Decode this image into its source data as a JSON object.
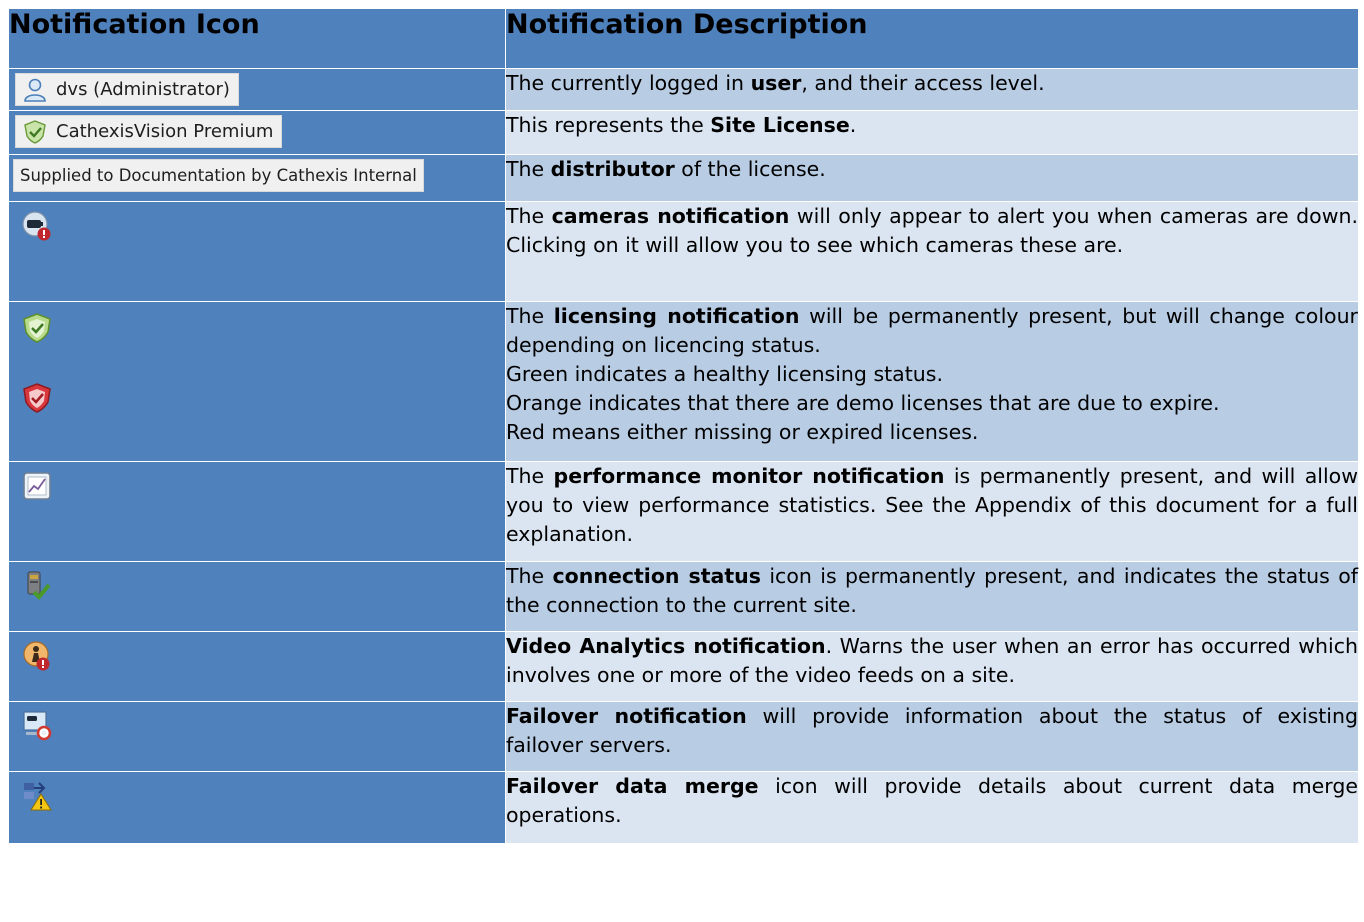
{
  "header": {
    "col_icon": "Notification Icon",
    "col_desc": "Notification Description"
  },
  "rows": [
    {
      "icon_text": "dvs (Administrator)",
      "icons": [
        "user-icon"
      ],
      "desc": [
        {
          "t": "The currently logged in "
        },
        {
          "t": "user",
          "b": true
        },
        {
          "t": ", and their access level."
        }
      ]
    },
    {
      "icon_text": "CathexisVision Premium",
      "icons": [
        "shield-check-green-icon"
      ],
      "desc": [
        {
          "t": "This represents the "
        },
        {
          "t": "Site License",
          "b": true
        },
        {
          "t": "."
        }
      ]
    },
    {
      "icon_text": "Supplied to Documentation by Cathexis Internal",
      "icons": [],
      "desc": [
        {
          "t": "The "
        },
        {
          "t": "distributor",
          "b": true
        },
        {
          "t": " of the license."
        }
      ]
    },
    {
      "icon_text": "",
      "icons": [
        "camera-alert-icon"
      ],
      "desc": [
        {
          "t": "The "
        },
        {
          "t": "cameras notification",
          "b": true
        },
        {
          "t": " will only appear to alert you when cameras are down. Clicking on it will allow you to see which cameras these are."
        }
      ]
    },
    {
      "icon_text": "",
      "icons": [
        "shield-green-icon",
        "shield-red-icon"
      ],
      "desc": [
        {
          "t": "The "
        },
        {
          "t": "licensing notification",
          "b": true
        },
        {
          "t": " will be permanently present, but will change colour depending on licencing status."
        },
        {
          "br": true
        },
        {
          "t": "Green indicates a healthy licensing status."
        },
        {
          "br": true
        },
        {
          "t": "Orange indicates that there are demo licenses that are due to expire."
        },
        {
          "br": true
        },
        {
          "t": "Red means either missing or expired licenses."
        }
      ]
    },
    {
      "icon_text": "",
      "icons": [
        "performance-chart-icon"
      ],
      "desc": [
        {
          "t": "The "
        },
        {
          "t": "performance monitor notification",
          "b": true
        },
        {
          "t": " is permanently present, and will allow you to view performance statistics. See the Appendix of this document for a full explanation."
        }
      ]
    },
    {
      "icon_text": "",
      "icons": [
        "connection-status-icon"
      ],
      "desc": [
        {
          "t": "The "
        },
        {
          "t": "connection status",
          "b": true
        },
        {
          "t": " icon is permanently present, and indicates the status of the connection to the current site."
        }
      ]
    },
    {
      "icon_text": "",
      "icons": [
        "video-analytics-icon"
      ],
      "desc": [
        {
          "t": "Video Analytics notification",
          "b": true
        },
        {
          "t": ". Warns the user when an error has occurred which involves one or more of the video feeds on a site."
        }
      ]
    },
    {
      "icon_text": "",
      "icons": [
        "failover-icon"
      ],
      "desc": [
        {
          "t": "Failover notification",
          "b": true
        },
        {
          "t": " will provide information about the status of existing failover servers."
        }
      ]
    },
    {
      "icon_text": "",
      "icons": [
        "failover-merge-icon"
      ],
      "desc": [
        {
          "t": "Failover data merge",
          "b": true
        },
        {
          "t": " icon will provide details about current data merge operations."
        }
      ]
    }
  ]
}
